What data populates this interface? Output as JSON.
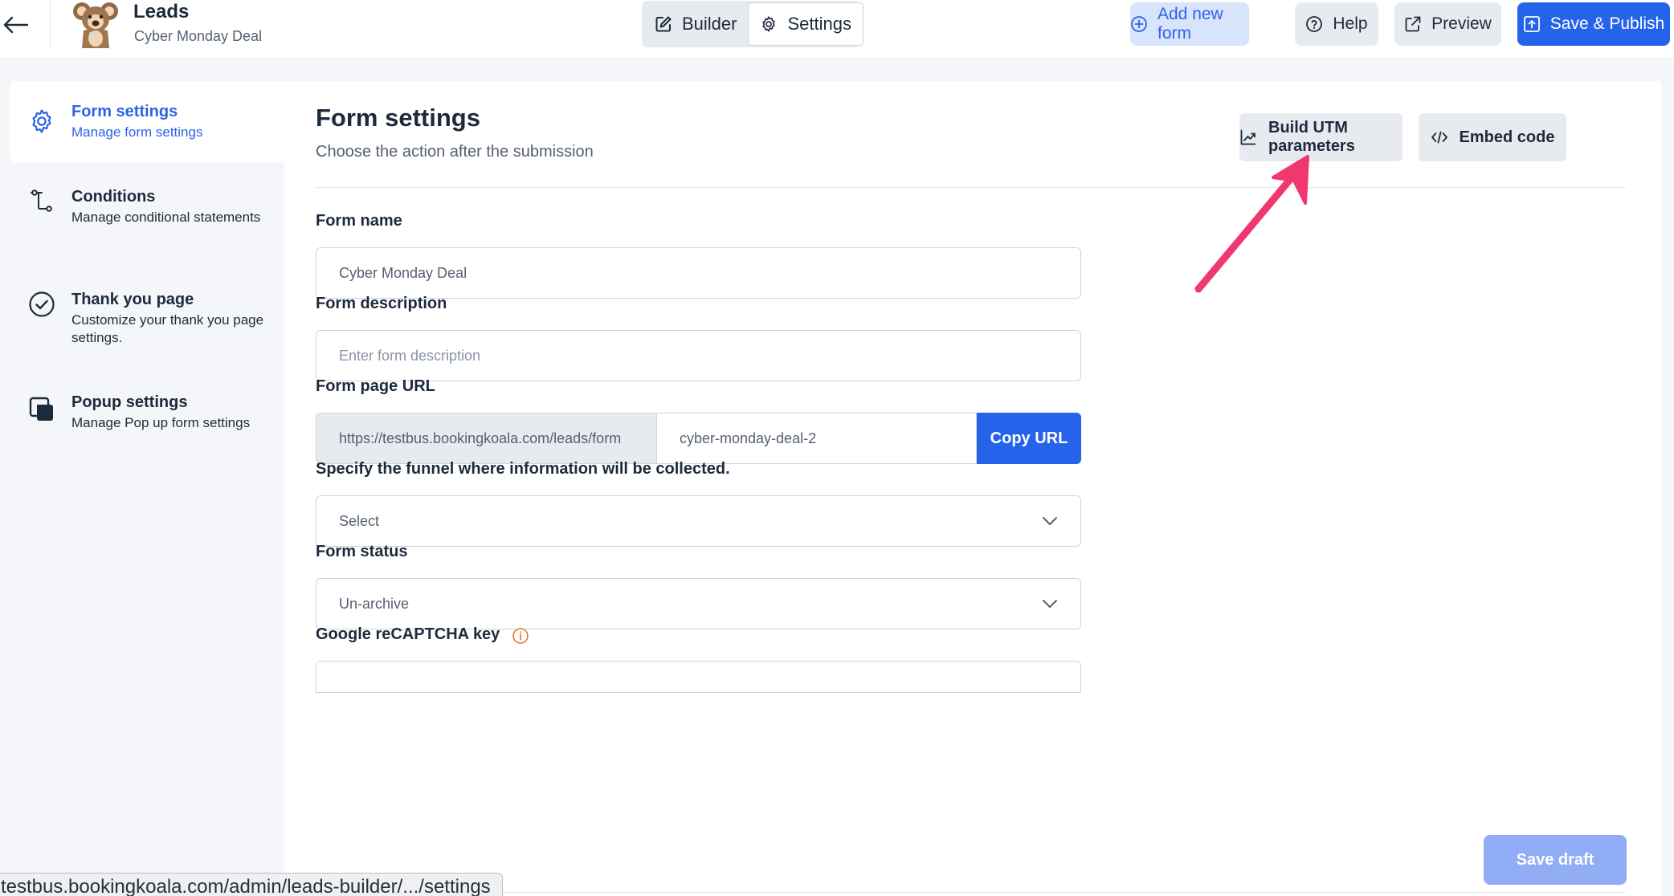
{
  "header": {
    "back_icon": "arrow-left-icon",
    "logo": "koala-logo",
    "title": "Leads",
    "subtitle": "Cyber Monday Deal",
    "modes": [
      {
        "label": "Builder",
        "icon": "edit-icon"
      },
      {
        "label": "Settings",
        "icon": "gear-icon",
        "selected": true
      }
    ],
    "buttons": {
      "add_new_form": "Add new form",
      "help": "Help",
      "preview": "Preview",
      "save_publish": "Save & Publish"
    }
  },
  "sidebar": {
    "items": [
      {
        "title": "Form settings",
        "description": "Manage form settings",
        "icon": "gear-icon",
        "active": true
      },
      {
        "title": "Conditions",
        "description": "Manage conditional statements",
        "icon": "branch-icon"
      },
      {
        "title": "Thank you page",
        "description": "Customize your thank you page settings.",
        "icon": "check-circle-icon"
      },
      {
        "title": "Popup settings",
        "description": "Manage Pop up form settings",
        "icon": "popup-icon"
      }
    ]
  },
  "main": {
    "title": "Form settings",
    "subtitle": "Choose the action after the submission",
    "buttons": {
      "utm": "Build UTM parameters",
      "embed": "Embed code"
    },
    "fields": {
      "form_name": {
        "label": "Form name",
        "value": "Cyber Monday Deal"
      },
      "form_description": {
        "label": "Form description",
        "placeholder": "Enter form description"
      },
      "form_url": {
        "label": "Form page URL",
        "prefix": "https://testbus.bookingkoala.com/leads/form",
        "slug": "cyber-monday-deal-2",
        "copy_label": "Copy URL"
      },
      "funnel": {
        "label": "Specify the funnel where information will be collected.",
        "value": "Select"
      },
      "form_status": {
        "label": "Form status",
        "value": "Un-archive"
      },
      "recaptcha": {
        "label": "Google reCAPTCHA key",
        "icon": "info-icon"
      }
    },
    "save_draft": "Save draft"
  },
  "annotation": {
    "type": "arrow",
    "color": "#f0376f",
    "points_to": "Build UTM parameters"
  },
  "status_bar": {
    "url": "testbus.bookingkoala.com/admin/leads-builder/.../settings"
  },
  "colors": {
    "primary": "#2563eb",
    "primary_light": "#d7e4fc",
    "save_draft": "#91adf6",
    "arrow": "#f0376f",
    "info": "#e8772e"
  }
}
